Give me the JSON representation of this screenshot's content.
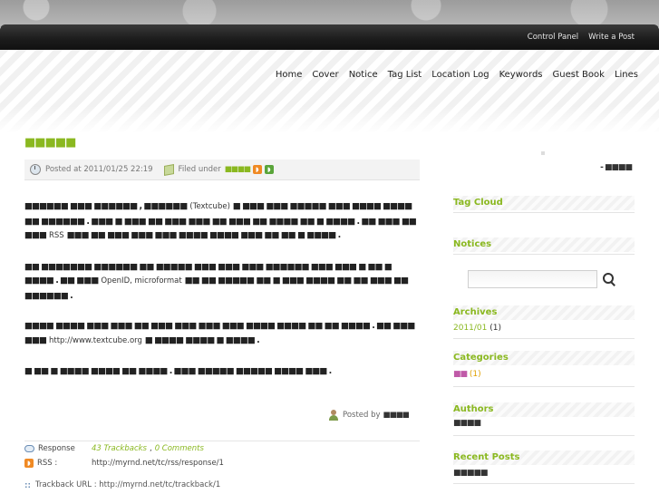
{
  "topbar": {
    "admin_links": [
      "Control Panel",
      "Write a Post"
    ]
  },
  "nav": {
    "items": [
      "Home",
      "Cover",
      "Notice",
      "Tag List",
      "Location Log",
      "Keywords",
      "Guest Book",
      "Lines"
    ]
  },
  "blog": {
    "title": "■■■■■"
  },
  "post": {
    "posted_at": "Posted at 2011/01/25 22:19",
    "filed_under": "Filed under",
    "category": "■■■■",
    "paragraphs": [
      {
        "a": "■■■■■■ ■■■ ■■■■■■ , ■■■■■■",
        "b": "(Textcube)",
        "c": "■ ■■■ ■■■ ■■■■■ ■■■ ■■■■ ■■■■ ■■ ■■■■■■ . ■■■ ■ ■■■ ■■ ■■■ ■■■ ■■ ■■■ ■■ ■■■■ ■■ ■ ■■■■ . ■■ ■■■ ■■ ■■■",
        "d": "RSS",
        "e": "■■■ ■■ ■■■ ■■■ ■■■ ■■■■ ■■■■ ■■■ ■■ ■■ ■ ■■■■ ."
      },
      {
        "a": "■■ ■■■■■■■ ■■■■■■ ■■ ■■■■■ ■■■ ■■■ ■■■ ■■■■■■ ■■■ ■■■ ■ ■■ ■ ■■■■ . ■■ ■■■",
        "b": "OpenID, microformat",
        "c": "■■ ■■ ■■■■■ ■■ ■ ■■■ ■■■■ ■■ ■■ ■■■ ■■ ■■■■■■ ."
      },
      {
        "a": "■■■■ ■■■■ ■■■ ■■■ ■■ ■■■ ■■■ ■■■ ■■■ ■■■■ ■■■■ ■■ ■■ ■■■■ . ■■ ■■■ ■■■",
        "b": "http://www.textcube.org",
        "c": "■ ■■■■ ■■■■ ■ ■■■■ ."
      },
      {
        "a": "■ ■■ ■ ■■■■ ■■■■ ■■ ■■■■ . ■■■ ■■■■■ ■■■■■ ■■■■ ■■■ .",
        "b": "",
        "c": ""
      }
    ],
    "posted_by": "Posted by",
    "author": "■■■■",
    "response_label": "Response",
    "trackbacks": "43 Trackbacks",
    "comments": "0 Comments",
    "rss_label": "RSS :",
    "rss_url": "http://myrnd.net/tc/rss/response/1",
    "trackback_url": "Trackback URL : http://myrnd.net/tc/trackback/1"
  },
  "sidebar": {
    "user": "- ■■■■",
    "tag_cloud": "Tag Cloud",
    "notices": "Notices",
    "archives": "Archives",
    "archive_month": "2011/01",
    "archive_count": "(1)",
    "categories": "Categories",
    "category_name": "■■",
    "category_count": "(1)",
    "authors": "Authors",
    "author_name": "■■■■",
    "recent_posts": "Recent Posts",
    "recent_post": "■■■■■"
  },
  "colors": {
    "accent_green": "#8ab820",
    "header_black": "#1b1b1b",
    "rss_orange": "#f08a24"
  }
}
